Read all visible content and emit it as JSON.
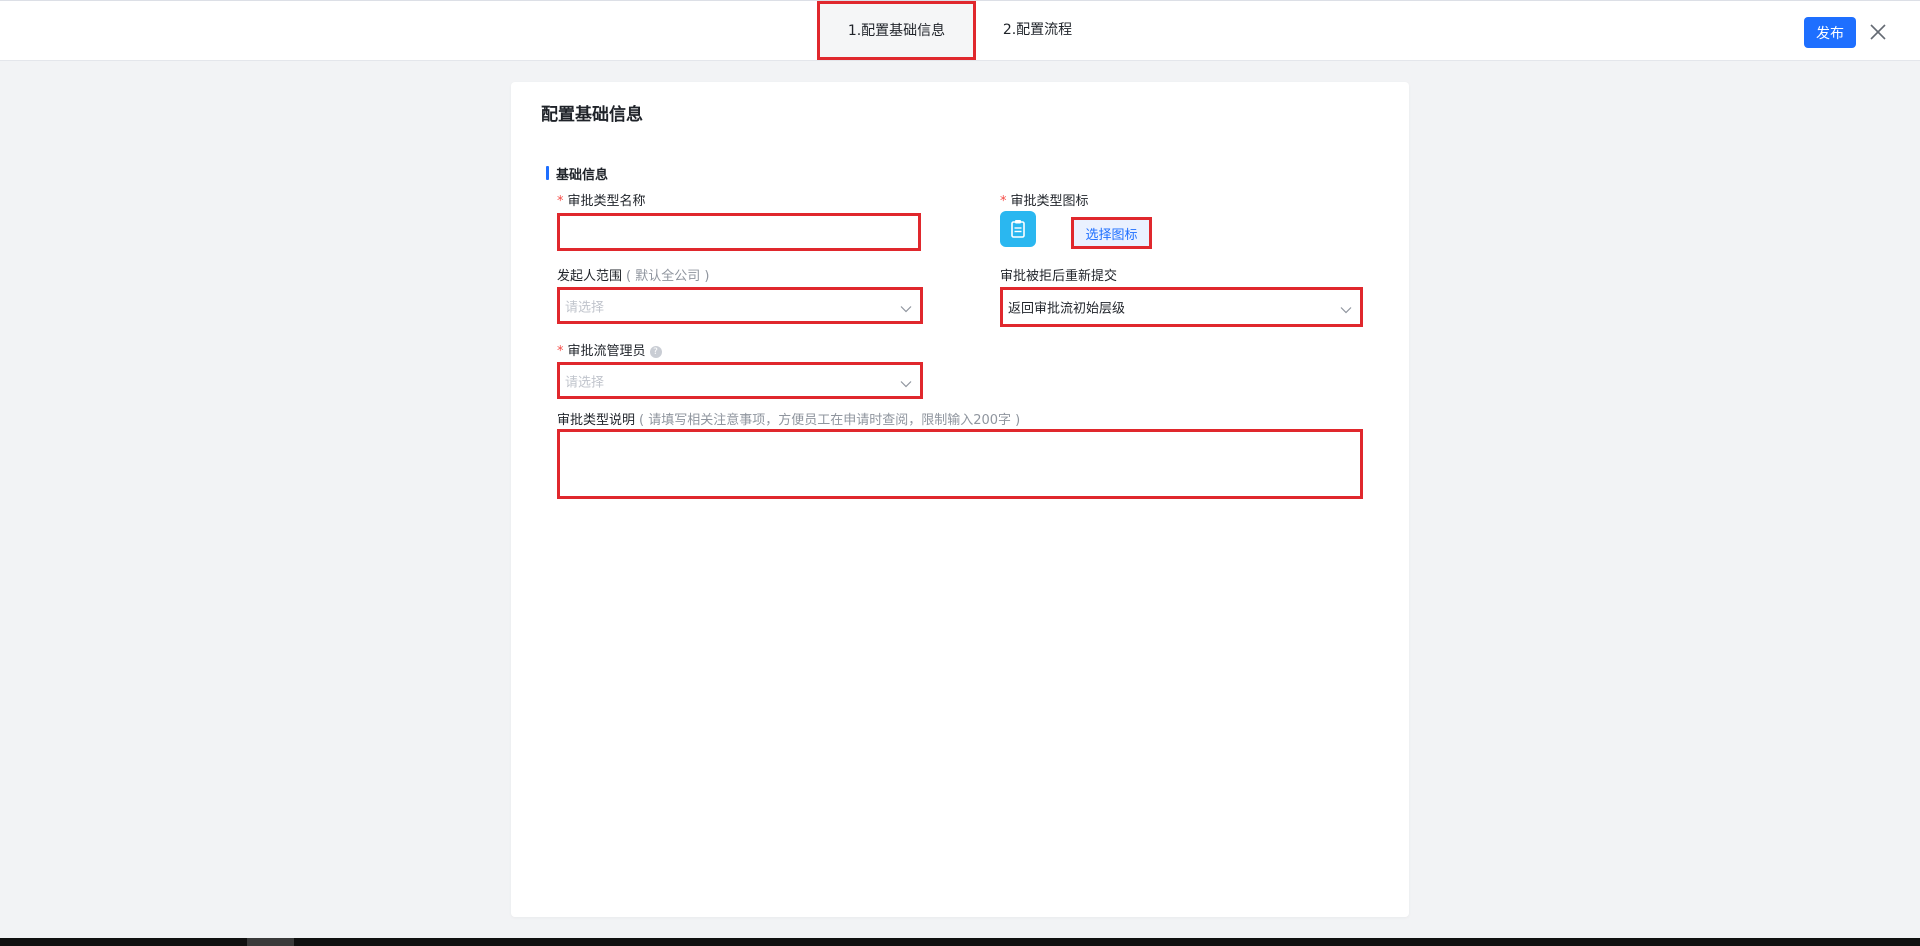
{
  "header": {
    "steps": [
      {
        "label": "1.配置基础信息",
        "active": true
      },
      {
        "label": "2.配置流程",
        "active": false
      }
    ],
    "publish_label": "发布",
    "close_icon": "close-icon"
  },
  "form": {
    "page_title": "配置基础信息",
    "section_title": "基础信息",
    "approval_name": {
      "label": "审批类型名称",
      "required": true,
      "value": ""
    },
    "approval_icon": {
      "label": "审批类型图标",
      "required": true,
      "icon": "clipboard-icon",
      "icon_color": "#2ab7f0",
      "button_label": "选择图标"
    },
    "initiator_scope": {
      "label": "发起人范围",
      "hint": "( 默认全公司 )",
      "placeholder": "请选择"
    },
    "resubmit_after_reject": {
      "label": "审批被拒后重新提交",
      "value": "返回审批流初始层级"
    },
    "flow_admin": {
      "label": "审批流管理员",
      "required": true,
      "placeholder": "请选择",
      "help_icon": "question-icon"
    },
    "description": {
      "label": "审批类型说明",
      "hint": "( 请填写相关注意事项，方便员工在申请时查阅，限制输入200字 )",
      "value": ""
    }
  },
  "colors": {
    "accent": "#1e6fff",
    "highlight_border": "#e0282d",
    "required_star": "#f54a45"
  }
}
